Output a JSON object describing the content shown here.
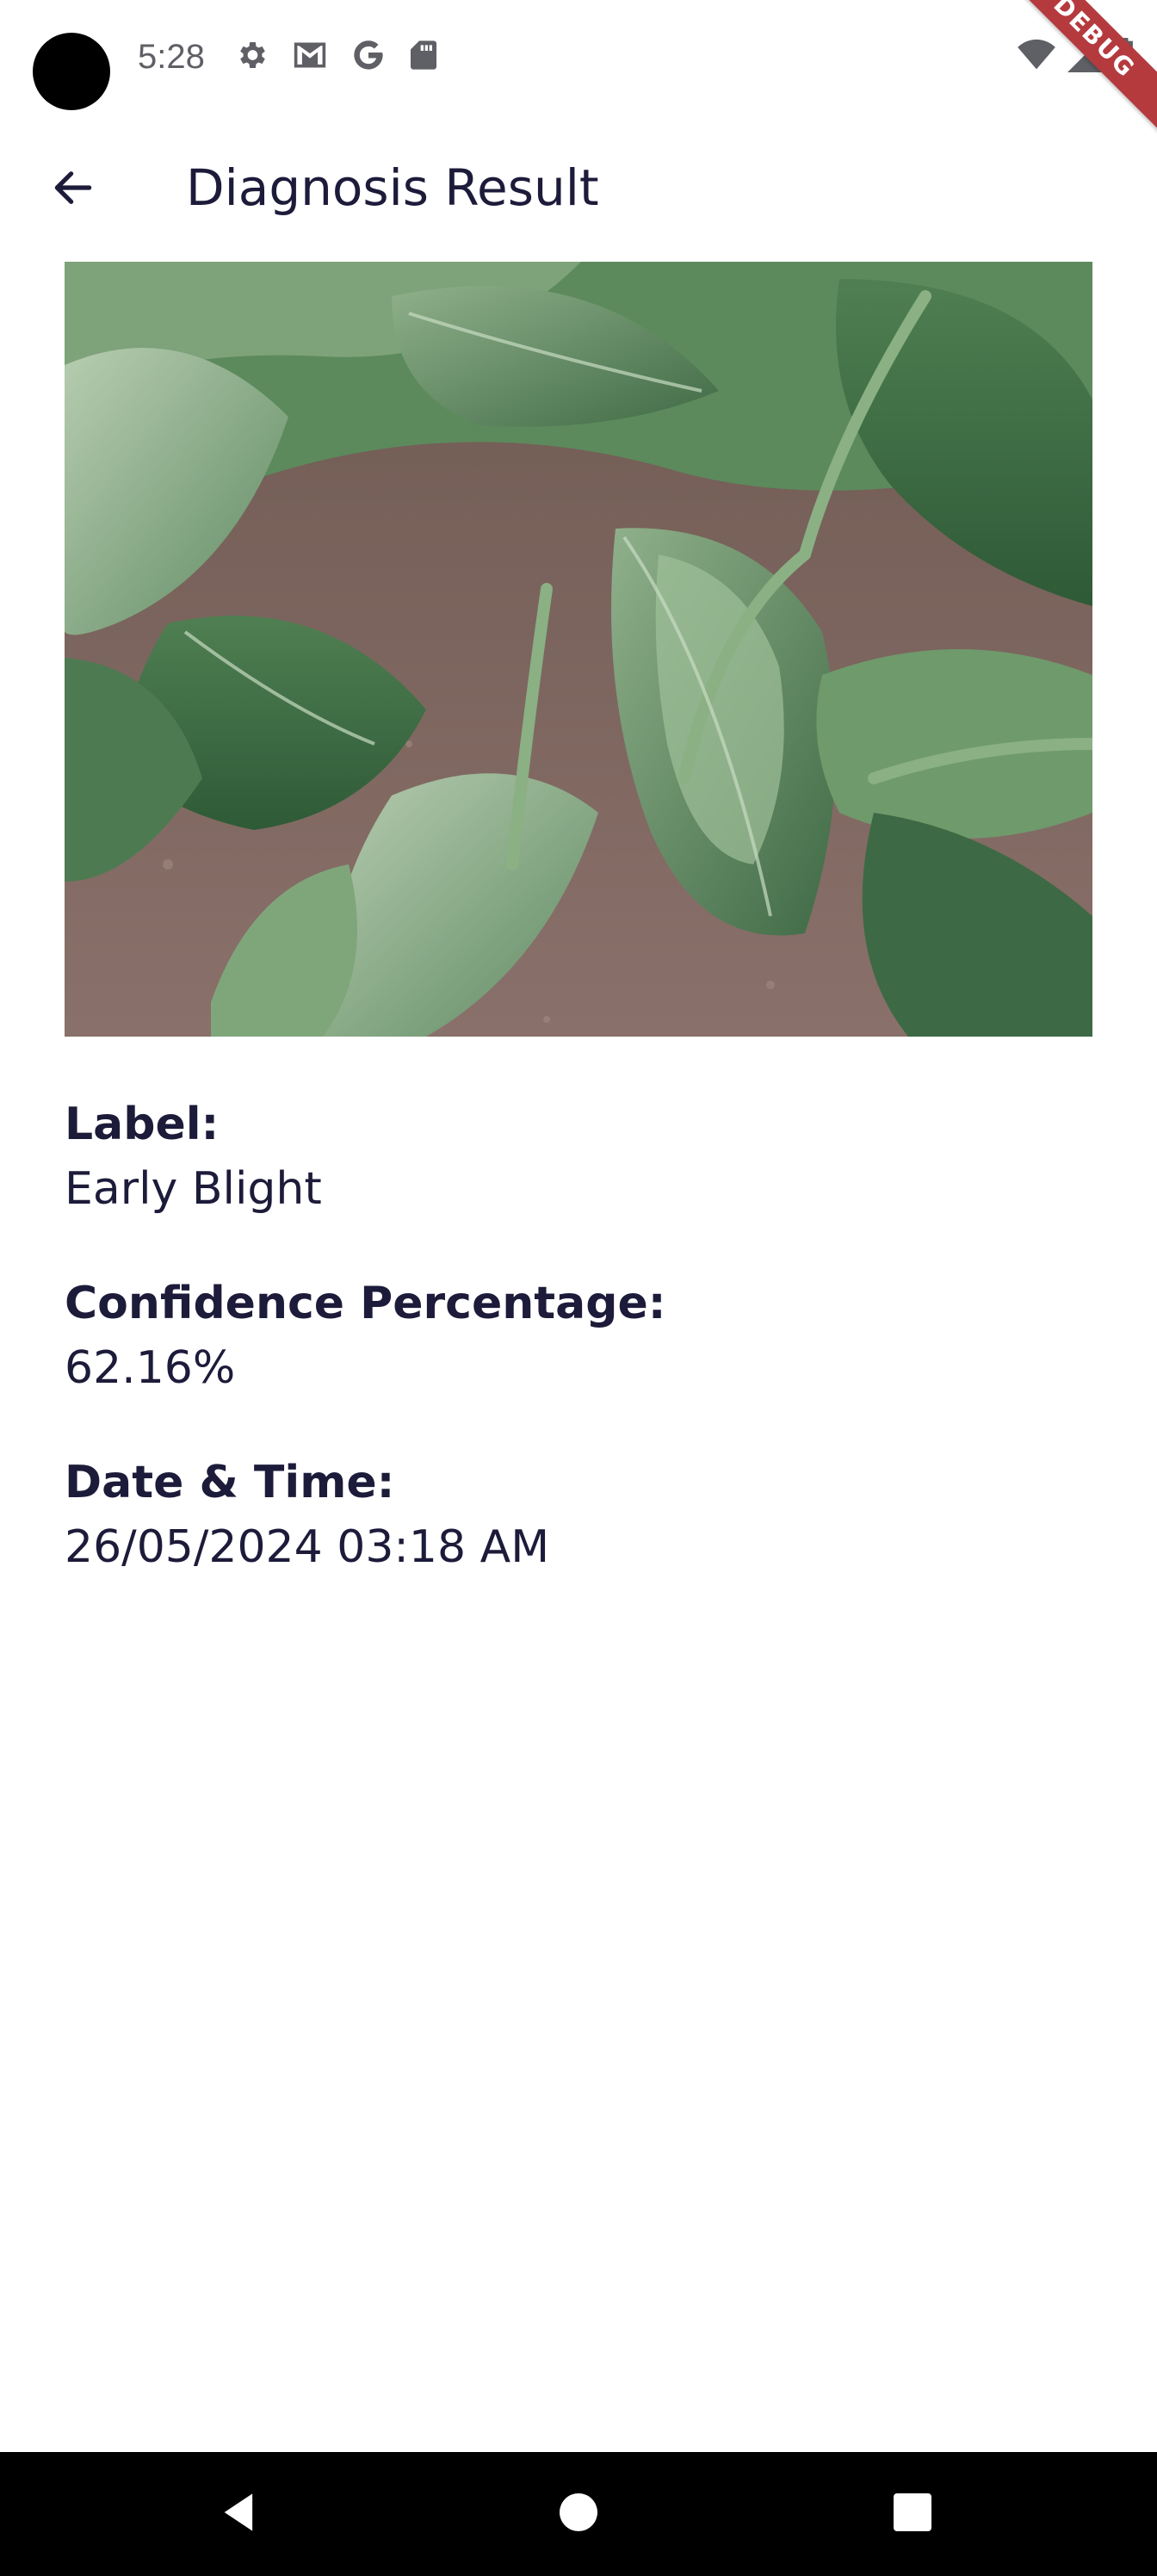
{
  "status_bar": {
    "time": "5:28",
    "icons": [
      "settings-icon",
      "gmail-icon",
      "google-icon",
      "sd-card-icon"
    ],
    "right_icons": [
      "wifi-icon",
      "signal-icon",
      "battery-icon"
    ]
  },
  "debug_banner": {
    "label": "DEBUG",
    "color": "#b53a3e"
  },
  "app_bar": {
    "back_icon": "arrow-back-icon",
    "title": "Diagnosis Result"
  },
  "image": {
    "subject": "tomato plant leaves"
  },
  "details": {
    "label_heading": "Label:",
    "label_value": "Early Blight",
    "confidence_heading": "Confidence Percentage:",
    "confidence_value": "62.16%",
    "datetime_heading": "Date & Time:",
    "datetime_value": "26/05/2024 03:18 AM"
  },
  "nav_bar": {
    "icons": [
      "nav-back-icon",
      "nav-home-icon",
      "nav-recents-icon"
    ]
  },
  "colors": {
    "text": "#1d1b3a",
    "background": "#ffffff",
    "nav_bar": "#000000"
  }
}
